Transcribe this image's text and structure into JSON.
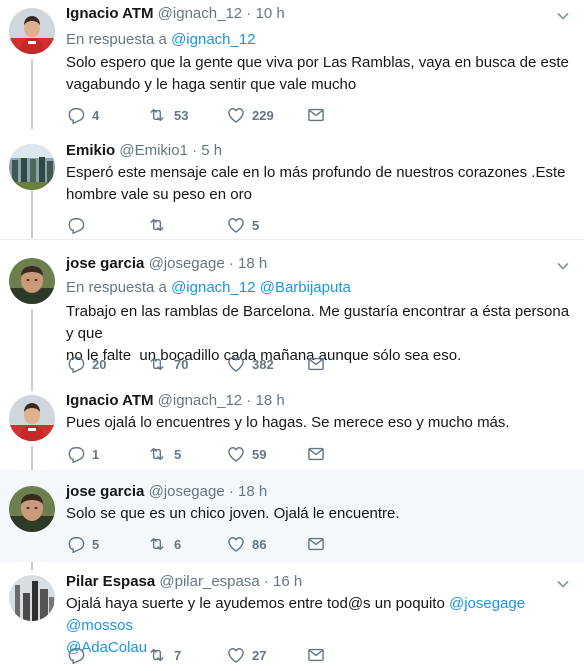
{
  "tweets": [
    {
      "name": "Ignacio ATM",
      "handle": "@ignach_12",
      "time": "· 10 h",
      "reply_prefix": "En respuesta a",
      "reply_mentions": [
        "@ignach_12"
      ],
      "text_lines": [
        "Solo espero que la gente que viva por Las Ramblas, vaya en busca de este",
        "vagabundo y le haga sentir que vale mucho"
      ],
      "replies": "4",
      "retweets": "53",
      "likes": "229"
    },
    {
      "name": "Emikio",
      "handle": "@Emikio1",
      "time": "· 5 h",
      "text_lines": [
        "Esperó este mensaje cale en lo más profundo de nuestros corazones .Este",
        "hombre vale su peso en oro"
      ],
      "replies": "",
      "retweets": "",
      "likes": "5"
    },
    {
      "name": "jose garcia",
      "handle": "@josegage",
      "time": "· 18 h",
      "reply_prefix": "En respuesta a",
      "reply_mentions": [
        "@ignach_12",
        "@Barbijaputa"
      ],
      "text_lines": [
        "Trabajo en las ramblas de Barcelona. Me gustaría encontrar a ésta persona y que",
        "no le falte  un bocadillo cada mañana aunque sólo sea eso."
      ],
      "replies": "20",
      "retweets": "70",
      "likes": "382"
    },
    {
      "name": "Ignacio ATM",
      "handle": "@ignach_12",
      "time": "· 18 h",
      "text_lines": [
        "Pues ojalá lo encuentres y lo hagas. Se merece eso y mucho más."
      ],
      "replies": "1",
      "retweets": "5",
      "likes": "59"
    },
    {
      "name": "jose garcia",
      "handle": "@josegage",
      "time": "· 18 h",
      "text_lines": [
        "Solo se que es un chico joven. Ojalá le encuentre."
      ],
      "replies": "5",
      "retweets": "6",
      "likes": "86"
    },
    {
      "name": "Pilar Espasa",
      "handle": "@pilar_espasa",
      "time": "· 16 h",
      "text_line1_plain": "Ojalá haya suerte y le ayudemos entre tod@s un poquito",
      "text_line1_mentions": "@josegage @mossos",
      "text_line2_mentions": "@AdaColau",
      "replies": "",
      "retweets": "7",
      "likes": "27"
    }
  ],
  "icons": {
    "reply": "reply-icon",
    "retweet": "retweet-icon",
    "like": "heart-icon",
    "dm": "envelope-icon",
    "more": "chevron-down-icon"
  },
  "colors": {
    "link": "#1b95e0",
    "muted": "#657786",
    "highlight_bg": "#f5f8fa",
    "thread_line": "#c4cfd6"
  }
}
